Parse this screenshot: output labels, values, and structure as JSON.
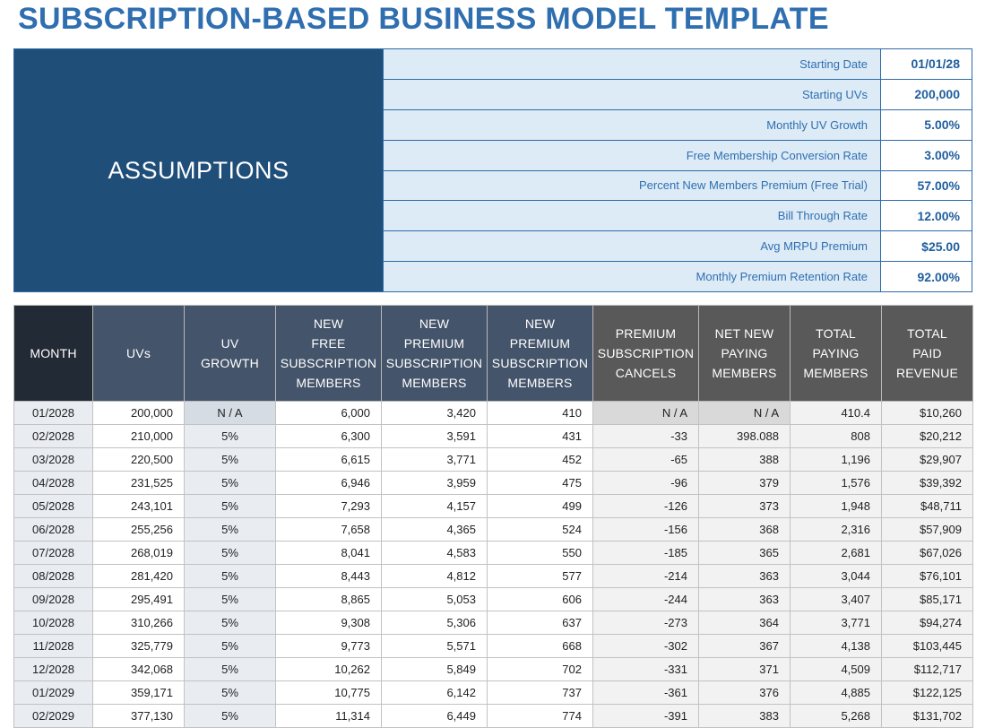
{
  "title": "SUBSCRIPTION-BASED BUSINESS MODEL TEMPLATE",
  "assumptions": {
    "heading": "ASSUMPTIONS",
    "rows": [
      {
        "label": "Starting Date",
        "value": "01/01/28"
      },
      {
        "label": "Starting UVs",
        "value": "200,000"
      },
      {
        "label": "Monthly UV Growth",
        "value": "5.00%"
      },
      {
        "label": "Free Membership Conversion Rate",
        "value": "3.00%"
      },
      {
        "label": "Percent New Members Premium (Free Trial)",
        "value": "57.00%"
      },
      {
        "label": "Bill Through Rate",
        "value": "12.00%"
      },
      {
        "label": "Avg MRPU Premium",
        "value": "$25.00"
      },
      {
        "label": "Monthly Premium Retention Rate",
        "value": "92.00%"
      }
    ]
  },
  "table": {
    "headers": [
      [
        "MONTH"
      ],
      [
        "UVs"
      ],
      [
        "UV",
        "GROWTH"
      ],
      [
        "NEW",
        "FREE",
        "SUBSCRIPTION",
        "MEMBERS"
      ],
      [
        "NEW",
        "PREMIUM",
        "SUBSCRIPTION",
        "MEMBERS"
      ],
      [
        "NEW",
        "PREMIUM",
        "SUBSCRIPTION",
        "MEMBERS"
      ],
      [
        "PREMIUM",
        "SUBSCRIPTION",
        "CANCELS"
      ],
      [
        "NET NEW",
        "PAYING",
        "MEMBERS"
      ],
      [
        "TOTAL",
        "PAYING",
        "MEMBERS"
      ],
      [
        "TOTAL",
        "PAID",
        "REVENUE"
      ]
    ],
    "rows": [
      [
        "01/2028",
        "200,000",
        "N / A",
        "6,000",
        "3,420",
        "410",
        "N / A",
        "N / A",
        "410.4",
        "$10,260"
      ],
      [
        "02/2028",
        "210,000",
        "5%",
        "6,300",
        "3,591",
        "431",
        "-33",
        "398.088",
        "808",
        "$20,212"
      ],
      [
        "03/2028",
        "220,500",
        "5%",
        "6,615",
        "3,771",
        "452",
        "-65",
        "388",
        "1,196",
        "$29,907"
      ],
      [
        "04/2028",
        "231,525",
        "5%",
        "6,946",
        "3,959",
        "475",
        "-96",
        "379",
        "1,576",
        "$39,392"
      ],
      [
        "05/2028",
        "243,101",
        "5%",
        "7,293",
        "4,157",
        "499",
        "-126",
        "373",
        "1,948",
        "$48,711"
      ],
      [
        "06/2028",
        "255,256",
        "5%",
        "7,658",
        "4,365",
        "524",
        "-156",
        "368",
        "2,316",
        "$57,909"
      ],
      [
        "07/2028",
        "268,019",
        "5%",
        "8,041",
        "4,583",
        "550",
        "-185",
        "365",
        "2,681",
        "$67,026"
      ],
      [
        "08/2028",
        "281,420",
        "5%",
        "8,443",
        "4,812",
        "577",
        "-214",
        "363",
        "3,044",
        "$76,101"
      ],
      [
        "09/2028",
        "295,491",
        "5%",
        "8,865",
        "5,053",
        "606",
        "-244",
        "363",
        "3,407",
        "$85,171"
      ],
      [
        "10/2028",
        "310,266",
        "5%",
        "9,308",
        "5,306",
        "637",
        "-273",
        "364",
        "3,771",
        "$94,274"
      ],
      [
        "11/2028",
        "325,779",
        "5%",
        "9,773",
        "5,571",
        "668",
        "-302",
        "367",
        "4,138",
        "$103,445"
      ],
      [
        "12/2028",
        "342,068",
        "5%",
        "10,262",
        "5,849",
        "702",
        "-331",
        "371",
        "4,509",
        "$112,717"
      ],
      [
        "01/2029",
        "359,171",
        "5%",
        "10,775",
        "6,142",
        "737",
        "-361",
        "376",
        "4,885",
        "$122,125"
      ],
      [
        "02/2029",
        "377,130",
        "5%",
        "11,314",
        "6,449",
        "774",
        "-391",
        "383",
        "5,268",
        "$131,702"
      ]
    ]
  }
}
